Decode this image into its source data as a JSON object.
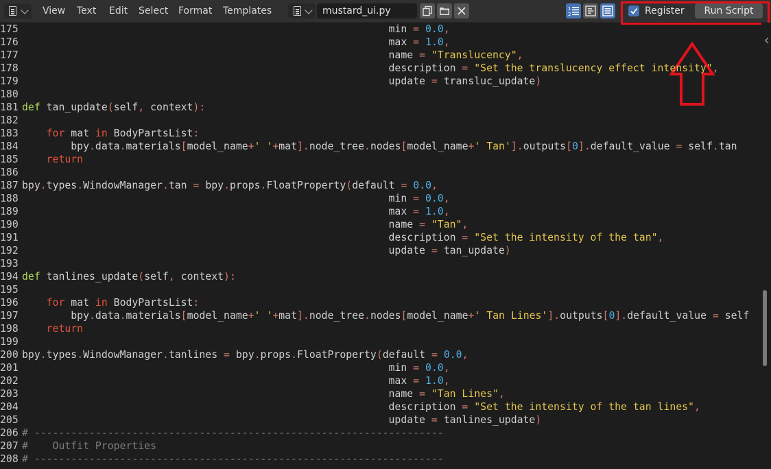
{
  "header": {
    "menus": [
      "View",
      "Text",
      "Edit",
      "Select",
      "Format",
      "Templates"
    ],
    "file_name": "mustard_ui.py",
    "register_label": "Register",
    "register_checked": true,
    "run_script_label": "Run Script"
  },
  "icons": {
    "editor_type": "text-editor-icon",
    "file_type": "text-file-icon",
    "new_text": "new-text-icon",
    "open_text": "folder-icon",
    "unlink_text": "close-icon",
    "line_numbers": "line-numbers-icon",
    "word_wrap": "word-wrap-icon",
    "syntax_highlight": "syntax-highlight-icon",
    "checkbox": "checkmark-icon",
    "annotation_arrow": "up-arrow-annotation"
  },
  "colors": {
    "annotation": "#e4121c",
    "accent": "#4772b3"
  },
  "code": {
    "lines": [
      {
        "n": "175",
        "t": [
          [
            "",
            "                                                            min "
          ],
          [
            "op",
            "="
          ],
          [
            "",
            ""
          ],
          [
            "num",
            " 0.0"
          ],
          [
            "op",
            ","
          ]
        ]
      },
      {
        "n": "176",
        "t": [
          [
            "",
            "                                                            max "
          ],
          [
            "op",
            "="
          ],
          [
            "num",
            " 1.0"
          ],
          [
            "op",
            ","
          ]
        ]
      },
      {
        "n": "177",
        "t": [
          [
            "",
            "                                                            name "
          ],
          [
            "op",
            "="
          ],
          [
            "str",
            " \"Translucency\""
          ],
          [
            "op",
            ","
          ]
        ]
      },
      {
        "n": "178",
        "t": [
          [
            "",
            "                                                            description "
          ],
          [
            "op",
            "="
          ],
          [
            "str",
            " \"Set the translucency effect intensity\""
          ],
          [
            "op",
            ","
          ]
        ]
      },
      {
        "n": "179",
        "t": [
          [
            "",
            "                                                            update "
          ],
          [
            "op",
            "="
          ],
          [
            "",
            " transluc_update"
          ],
          [
            "op",
            ")"
          ]
        ]
      },
      {
        "n": "180",
        "t": []
      },
      {
        "n": "181",
        "t": [
          [
            "def",
            "def"
          ],
          [
            "",
            " tan_update"
          ],
          [
            "op",
            "("
          ],
          [
            "",
            "self"
          ],
          [
            "op",
            ","
          ],
          [
            "",
            " context"
          ],
          [
            "op",
            "):"
          ]
        ]
      },
      {
        "n": "182",
        "t": []
      },
      {
        "n": "183",
        "t": [
          [
            "",
            "    "
          ],
          [
            "kw",
            "for"
          ],
          [
            "",
            " mat "
          ],
          [
            "kw",
            "in"
          ],
          [
            "",
            " BodyPartsList"
          ],
          [
            "op",
            ":"
          ]
        ]
      },
      {
        "n": "184",
        "t": [
          [
            "",
            "        bpy"
          ],
          [
            "op",
            "."
          ],
          [
            "",
            "data"
          ],
          [
            "op",
            "."
          ],
          [
            "",
            "materials"
          ],
          [
            "op",
            "["
          ],
          [
            "",
            "model_name"
          ],
          [
            "op",
            "+"
          ],
          [
            "str",
            "' '"
          ],
          [
            "op",
            "+"
          ],
          [
            "",
            "mat"
          ],
          [
            "op",
            "]."
          ],
          [
            "",
            "node_tree"
          ],
          [
            "op",
            "."
          ],
          [
            "",
            "nodes"
          ],
          [
            "op",
            "["
          ],
          [
            "",
            "model_name"
          ],
          [
            "op",
            "+"
          ],
          [
            "str",
            "' Tan'"
          ],
          [
            "op",
            "]."
          ],
          [
            "",
            "outputs"
          ],
          [
            "op",
            "["
          ],
          [
            "num",
            "0"
          ],
          [
            "op",
            "]."
          ],
          [
            "",
            "default_value "
          ],
          [
            "op",
            "="
          ],
          [
            "",
            " self"
          ],
          [
            "op",
            "."
          ],
          [
            "",
            "tan"
          ]
        ]
      },
      {
        "n": "185",
        "t": [
          [
            "",
            "    "
          ],
          [
            "kw",
            "return"
          ]
        ]
      },
      {
        "n": "186",
        "t": []
      },
      {
        "n": "187",
        "t": [
          [
            "",
            "bpy"
          ],
          [
            "op",
            "."
          ],
          [
            "",
            "types"
          ],
          [
            "op",
            "."
          ],
          [
            "",
            "WindowManager"
          ],
          [
            "op",
            "."
          ],
          [
            "",
            "tan "
          ],
          [
            "op",
            "="
          ],
          [
            "",
            " bpy"
          ],
          [
            "op",
            "."
          ],
          [
            "",
            "props"
          ],
          [
            "op",
            "."
          ],
          [
            "",
            "FloatProperty"
          ],
          [
            "op",
            "("
          ],
          [
            "",
            "default "
          ],
          [
            "op",
            "="
          ],
          [
            "num",
            " 0.0"
          ],
          [
            "op",
            ","
          ]
        ]
      },
      {
        "n": "188",
        "t": [
          [
            "",
            "                                                            min "
          ],
          [
            "op",
            "="
          ],
          [
            "num",
            " 0.0"
          ],
          [
            "op",
            ","
          ]
        ]
      },
      {
        "n": "189",
        "t": [
          [
            "",
            "                                                            max "
          ],
          [
            "op",
            "="
          ],
          [
            "num",
            " 1.0"
          ],
          [
            "op",
            ","
          ]
        ]
      },
      {
        "n": "190",
        "t": [
          [
            "",
            "                                                            name "
          ],
          [
            "op",
            "="
          ],
          [
            "str",
            " \"Tan\""
          ],
          [
            "op",
            ","
          ]
        ]
      },
      {
        "n": "191",
        "t": [
          [
            "",
            "                                                            description "
          ],
          [
            "op",
            "="
          ],
          [
            "str",
            " \"Set the intensity of the tan\""
          ],
          [
            "op",
            ","
          ]
        ]
      },
      {
        "n": "192",
        "t": [
          [
            "",
            "                                                            update "
          ],
          [
            "op",
            "="
          ],
          [
            "",
            " tan_update"
          ],
          [
            "op",
            ")"
          ]
        ]
      },
      {
        "n": "193",
        "t": []
      },
      {
        "n": "194",
        "t": [
          [
            "def",
            "def"
          ],
          [
            "",
            " tanlines_update"
          ],
          [
            "op",
            "("
          ],
          [
            "",
            "self"
          ],
          [
            "op",
            ","
          ],
          [
            "",
            " context"
          ],
          [
            "op",
            "):"
          ]
        ]
      },
      {
        "n": "195",
        "t": []
      },
      {
        "n": "196",
        "t": [
          [
            "",
            "    "
          ],
          [
            "kw",
            "for"
          ],
          [
            "",
            " mat "
          ],
          [
            "kw",
            "in"
          ],
          [
            "",
            " BodyPartsList"
          ],
          [
            "op",
            ":"
          ]
        ]
      },
      {
        "n": "197",
        "t": [
          [
            "",
            "        bpy"
          ],
          [
            "op",
            "."
          ],
          [
            "",
            "data"
          ],
          [
            "op",
            "."
          ],
          [
            "",
            "materials"
          ],
          [
            "op",
            "["
          ],
          [
            "",
            "model_name"
          ],
          [
            "op",
            "+"
          ],
          [
            "str",
            "' '"
          ],
          [
            "op",
            "+"
          ],
          [
            "",
            "mat"
          ],
          [
            "op",
            "]."
          ],
          [
            "",
            "node_tree"
          ],
          [
            "op",
            "."
          ],
          [
            "",
            "nodes"
          ],
          [
            "op",
            "["
          ],
          [
            "",
            "model_name"
          ],
          [
            "op",
            "+"
          ],
          [
            "str",
            "' Tan Lines'"
          ],
          [
            "op",
            "]."
          ],
          [
            "",
            "outputs"
          ],
          [
            "op",
            "["
          ],
          [
            "num",
            "0"
          ],
          [
            "op",
            "]."
          ],
          [
            "",
            "default_value "
          ],
          [
            "op",
            "="
          ],
          [
            "",
            " self"
          ]
        ]
      },
      {
        "n": "198",
        "t": [
          [
            "",
            "    "
          ],
          [
            "kw",
            "return"
          ]
        ]
      },
      {
        "n": "199",
        "t": []
      },
      {
        "n": "200",
        "t": [
          [
            "",
            "bpy"
          ],
          [
            "op",
            "."
          ],
          [
            "",
            "types"
          ],
          [
            "op",
            "."
          ],
          [
            "",
            "WindowManager"
          ],
          [
            "op",
            "."
          ],
          [
            "",
            "tanlines "
          ],
          [
            "op",
            "="
          ],
          [
            "",
            " bpy"
          ],
          [
            "op",
            "."
          ],
          [
            "",
            "props"
          ],
          [
            "op",
            "."
          ],
          [
            "",
            "FloatProperty"
          ],
          [
            "op",
            "("
          ],
          [
            "",
            "default "
          ],
          [
            "op",
            "="
          ],
          [
            "num",
            " 0.0"
          ],
          [
            "op",
            ","
          ]
        ]
      },
      {
        "n": "201",
        "t": [
          [
            "",
            "                                                            min "
          ],
          [
            "op",
            "="
          ],
          [
            "num",
            " 0.0"
          ],
          [
            "op",
            ","
          ]
        ]
      },
      {
        "n": "202",
        "t": [
          [
            "",
            "                                                            max "
          ],
          [
            "op",
            "="
          ],
          [
            "num",
            " 1.0"
          ],
          [
            "op",
            ","
          ]
        ]
      },
      {
        "n": "203",
        "t": [
          [
            "",
            "                                                            name "
          ],
          [
            "op",
            "="
          ],
          [
            "str",
            " \"Tan Lines\""
          ],
          [
            "op",
            ","
          ]
        ]
      },
      {
        "n": "204",
        "t": [
          [
            "",
            "                                                            description "
          ],
          [
            "op",
            "="
          ],
          [
            "str",
            " \"Set the intensity of the tan lines\""
          ],
          [
            "op",
            ","
          ]
        ]
      },
      {
        "n": "205",
        "t": [
          [
            "",
            "                                                            update "
          ],
          [
            "op",
            "="
          ],
          [
            "",
            " tanlines_update"
          ],
          [
            "op",
            ")"
          ]
        ]
      },
      {
        "n": "206",
        "t": [
          [
            "cm",
            "# -------------------------------------------------------------------"
          ]
        ]
      },
      {
        "n": "207",
        "t": [
          [
            "cm",
            "#    Outfit Properties"
          ]
        ]
      },
      {
        "n": "208",
        "t": [
          [
            "cm",
            "# -------------------------------------------------------------------"
          ]
        ]
      }
    ]
  }
}
